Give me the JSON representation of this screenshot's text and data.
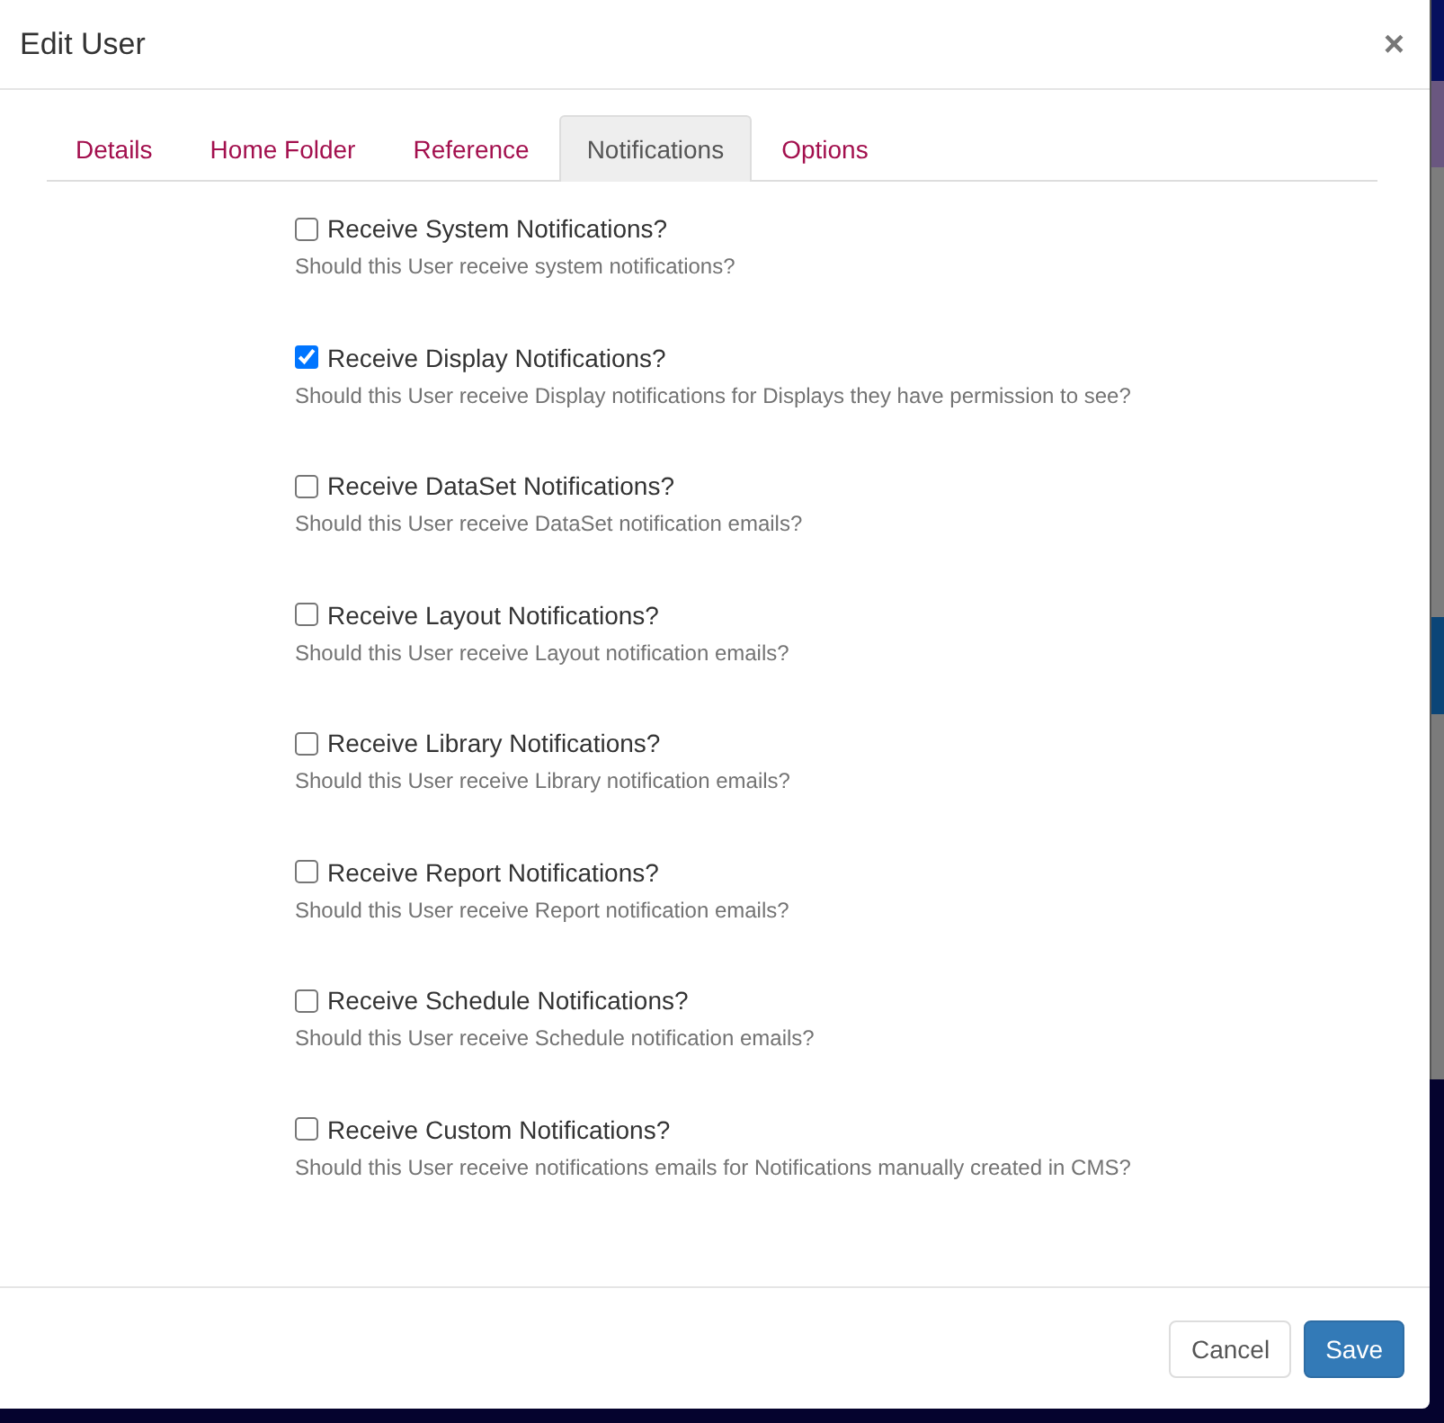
{
  "dialog": {
    "title": "Edit User",
    "close": "×"
  },
  "tabs": [
    {
      "label": "Details",
      "selected": false
    },
    {
      "label": "Home Folder",
      "selected": false
    },
    {
      "label": "Reference",
      "selected": false
    },
    {
      "label": "Notifications",
      "selected": true
    },
    {
      "label": "Options",
      "selected": false
    }
  ],
  "options": [
    {
      "label": "Receive System Notifications?",
      "help": "Should this User receive system notifications?",
      "checked": false
    },
    {
      "label": "Receive Display Notifications?",
      "help": "Should this User receive Display notifications for Displays they have permission to see?",
      "checked": true
    },
    {
      "label": "Receive DataSet Notifications?",
      "help": "Should this User receive DataSet notification emails?",
      "checked": false
    },
    {
      "label": "Receive Layout Notifications?",
      "help": "Should this User receive Layout notification emails?",
      "checked": false
    },
    {
      "label": "Receive Library Notifications?",
      "help": "Should this User receive Library notification emails?",
      "checked": false
    },
    {
      "label": "Receive Report Notifications?",
      "help": "Should this User receive Report notification emails?",
      "checked": false
    },
    {
      "label": "Receive Schedule Notifications?",
      "help": "Should this User receive Schedule notification emails?",
      "checked": false
    },
    {
      "label": "Receive Custom Notifications?",
      "help": "Should this User receive notifications emails for Notifications manually created in CMS?",
      "checked": false
    }
  ],
  "buttons": [
    {
      "label": "Cancel",
      "kind": "default"
    },
    {
      "label": "Save",
      "kind": "primary"
    }
  ]
}
